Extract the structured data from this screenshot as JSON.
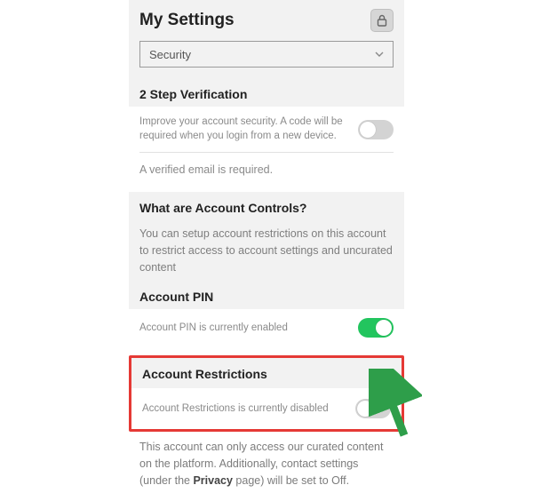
{
  "header": {
    "title": "My Settings",
    "lock_icon": "lock-icon"
  },
  "selector": {
    "selected": "Security"
  },
  "two_step": {
    "heading": "2 Step Verification",
    "desc": "Improve your account security. A code will be required when you login from a new device.",
    "note": "A verified email is required."
  },
  "controls": {
    "heading": "What are Account Controls?",
    "desc": "You can setup account restrictions on this account to restrict access to account settings and uncurated content"
  },
  "pin": {
    "heading": "Account PIN",
    "status": "Account PIN is currently enabled"
  },
  "restrictions": {
    "heading": "Account Restrictions",
    "status": "Account Restrictions is currently disabled",
    "footer_a": "This account can only access our curated content on the platform. Additionally, contact settings (under the ",
    "footer_strong": "Privacy",
    "footer_b": " page) will be set to Off."
  },
  "toggles": {
    "two_step": false,
    "pin": true,
    "restrictions": false
  },
  "colors": {
    "highlight": "#e53935",
    "arrow": "#2e9e4a",
    "toggle_on": "#22c55e"
  }
}
